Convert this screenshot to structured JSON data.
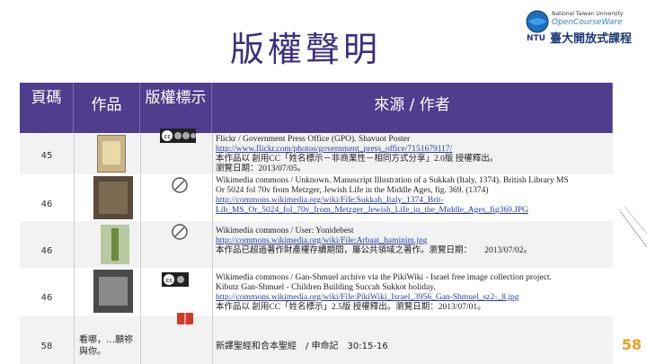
{
  "title": "版權聲明",
  "logo": {
    "en_line1": "National Taiwan University",
    "en_line2": "OpenCourseWare",
    "zh": "臺大開放式課程",
    "ntu": "NTU"
  },
  "table": {
    "headers": {
      "page": "頁碼",
      "work": "作品",
      "license": "版權標示",
      "source": "來源 / 作者"
    },
    "rows": [
      {
        "page": "45",
        "lines": [
          {
            "text": "Flickr / Government Press Office (GPO). Shavuot Poster",
            "style": "plain"
          },
          {
            "text": "http://www.flickr.com/photos/government_press_office/7151679117/",
            "style": "url"
          },
          {
            "text": "本作品以 創用CC「姓名標示－非商業性－相同方式分享」2.0版 授權釋出。",
            "style": "plain"
          },
          {
            "text": "瀏覽日期：2013/07/05。",
            "style": "plain"
          }
        ]
      },
      {
        "page": "46",
        "lines": [
          {
            "text": "Wikimedia commons / Unknown. Manuscript Illustration of a Sukkah (Italy, 1374). British Library MS",
            "style": "plain"
          },
          {
            "text": "Or 5024 fol 70v from Metzger, Jewish Life in the Middle Ages, fig. 369. (1374)",
            "style": "plain"
          },
          {
            "text": "http://commons.wikimedia.org/wiki/File:Sukkah_Italy_1374_Brit-",
            "style": "url"
          },
          {
            "text": "Lib_MS_Or_5024_fol_70v_from_Metzger_Jewish_Life_in_the_Middle_Ages_fig369.JPG",
            "style": "url"
          }
        ]
      },
      {
        "page": "46",
        "lines": [
          {
            "text": "Wikimedia commons / User: Yonidebest",
            "style": "plain"
          },
          {
            "text": "http://commons.wikimedia.org/wiki/File:Arbaat_haminim.jpg",
            "style": "url"
          },
          {
            "text": "本作品已超過著作財產權存續期間，屬公共領域之著作。瀏覽日期：　　2013/07/02。",
            "style": "plain"
          }
        ]
      },
      {
        "page": "46",
        "lines": [
          {
            "text": "Wikimedia commons / Gan-Shmuel archive via the PikiWiki - Israel free image collection project.",
            "style": "plain"
          },
          {
            "text": "Kibutz Gan-Shmuel - Children Building Succah Sukkot holiday.",
            "style": "plain"
          },
          {
            "text": "http://commons.wikimedia.org/wiki/File:PikiWiki_Israel_3956_Gan-Shmuel_sz2-_8.jpg",
            "style": "url"
          },
          {
            "text": "本作品以 創用CC「姓名標示」2.5版 授權釋出。瀏覽日期：2013/07/01。",
            "style": "plain"
          }
        ]
      },
      {
        "page": "58",
        "work_text": "看哪，…願祢與你。",
        "lines": [
          {
            "text": "新譯聖經和合本聖經　/ 申命記　30:15-16",
            "style": "plain"
          }
        ]
      }
    ]
  },
  "page_number": "58",
  "colors": {
    "header_bg": "#4f3d8d",
    "title": "#3f2e7c",
    "row_alt": "#f2f2f2",
    "link": "#2a3ea0"
  }
}
